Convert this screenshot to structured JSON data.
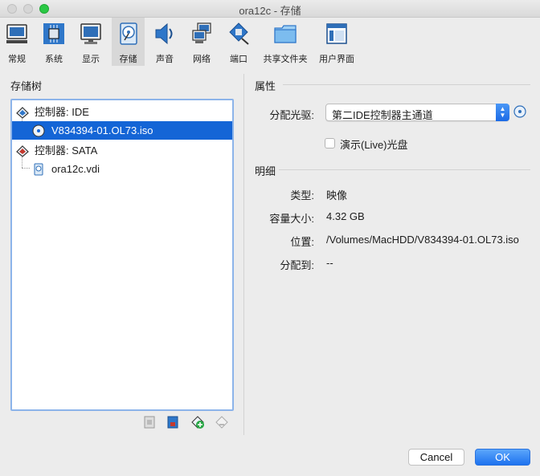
{
  "window": {
    "title": "ora12c - 存储"
  },
  "toolbar": {
    "items": [
      {
        "label": "常规",
        "icon": "monitor-general-icon"
      },
      {
        "label": "系统",
        "icon": "chip-icon"
      },
      {
        "label": "显示",
        "icon": "display-icon"
      },
      {
        "label": "存储",
        "icon": "storage-disk-icon",
        "selected": true
      },
      {
        "label": "声音",
        "icon": "speaker-icon"
      },
      {
        "label": "网络",
        "icon": "network-icon"
      },
      {
        "label": "端口",
        "icon": "port-icon"
      },
      {
        "label": "共享文件夹",
        "icon": "folder-icon"
      },
      {
        "label": "用户界面",
        "icon": "user-interface-icon"
      }
    ]
  },
  "storage_tree": {
    "title": "存储树",
    "controllers": [
      {
        "label": "控制器: IDE",
        "attachments": [
          {
            "label": "V834394-01.OL73.iso",
            "type": "optical",
            "selected": true
          }
        ]
      },
      {
        "label": "控制器: SATA",
        "attachments": [
          {
            "label": "ora12c.vdi",
            "type": "hard-disk"
          }
        ]
      }
    ],
    "tools": [
      "remove-controller-icon",
      "add-controller-icon",
      "add-attachment-icon",
      "remove-attachment-icon"
    ]
  },
  "attributes": {
    "title": "属性",
    "drive_label": "分配光驱:",
    "drive_value": "第二IDE控制器主通道",
    "live_cd_label": "演示(Live)光盘",
    "live_cd_checked": false
  },
  "details": {
    "title": "明细",
    "rows": [
      {
        "label": "类型:",
        "value": "映像"
      },
      {
        "label": "容量大小:",
        "value": "4.32 GB"
      },
      {
        "label": "位置:",
        "value": "/Volumes/MacHDD/V834394-01.OL73.iso"
      },
      {
        "label": "分配到:",
        "value": "--"
      }
    ]
  },
  "buttons": {
    "cancel": "Cancel",
    "ok": "OK"
  },
  "colors": {
    "selection": "#1465d6",
    "accent": "#1e72ef",
    "focus_ring": "#8cb4ea"
  }
}
